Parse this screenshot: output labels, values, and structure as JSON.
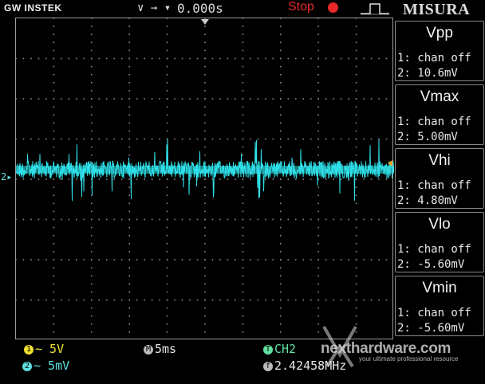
{
  "header": {
    "brand": "GW INSTEK",
    "trigger_mode": "∨ → ▾",
    "trigger_time": "0.000s",
    "run_state": "Stop",
    "panel_title": "MISURA"
  },
  "measurements": [
    {
      "name": "Vpp",
      "ch1": "1: chan off",
      "ch2": "2: 10.6mV"
    },
    {
      "name": "Vmax",
      "ch1": "1: chan off",
      "ch2": "2: 5.00mV"
    },
    {
      "name": "Vhi",
      "ch1": "1: chan off",
      "ch2": "2: 4.80mV"
    },
    {
      "name": "Vlo",
      "ch1": "1: chan off",
      "ch2": "2: -5.60mV"
    },
    {
      "name": "Vmin",
      "ch1": "1: chan off",
      "ch2": "2: -5.60mV"
    }
  ],
  "footer": {
    "ch1_badge": "1",
    "ch1_scale": "∼ 5V",
    "ch2_badge": "2",
    "ch2_scale": "∼ 5mV",
    "time_badge": "M",
    "time_scale": "5ms",
    "trig_badge": "T",
    "trig_source": "CH2",
    "freq_badge": "f",
    "frequency": "2.42458MHz",
    "watermark": "nexthardware.com",
    "watermark_tagline": "your ultimate professional resource"
  },
  "waveform": {
    "channel_label": "2",
    "color": "#2fe0e8"
  },
  "colors": {
    "ch1": "#f0e030",
    "ch2": "#5fe0e0",
    "stop": "#e82828",
    "grid": "#9a9a9a"
  }
}
